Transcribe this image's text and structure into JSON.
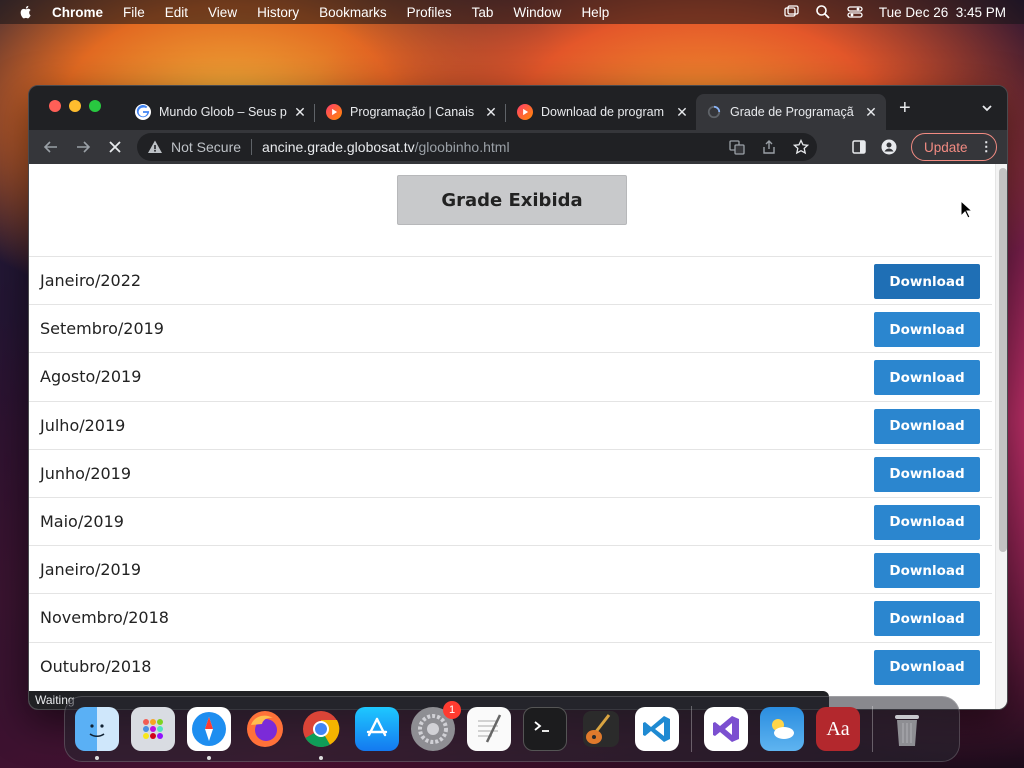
{
  "menubar": {
    "app_name": "Chrome",
    "items": [
      "File",
      "Edit",
      "View",
      "History",
      "Bookmarks",
      "Profiles",
      "Tab",
      "Window",
      "Help"
    ],
    "datetime": "Tue Dec 26  3:45 PM"
  },
  "tabs": [
    {
      "title": "Mundo Gloob – Seus p",
      "icon": "google-icon",
      "active": false
    },
    {
      "title": "Programação | Canais",
      "icon": "globoplay-icon",
      "active": false
    },
    {
      "title": "Download de program",
      "icon": "globoplay-icon",
      "active": false
    },
    {
      "title": "Grade de Programaçã",
      "icon": "loading-spinner-icon",
      "active": true
    }
  ],
  "toolbar": {
    "security_label": "Not Secure",
    "url_host": "ancine.grade.globosat.tv",
    "url_path": "/gloobinho.html",
    "update_label": "Update"
  },
  "page": {
    "header_button": "Grade Exibida",
    "download_label": "Download",
    "rows": [
      {
        "label": "Janeiro/2022",
        "hovered": true
      },
      {
        "label": "Setembro/2019",
        "hovered": false
      },
      {
        "label": "Agosto/2019",
        "hovered": false
      },
      {
        "label": "Julho/2019",
        "hovered": false
      },
      {
        "label": "Junho/2019",
        "hovered": false
      },
      {
        "label": "Maio/2019",
        "hovered": false
      },
      {
        "label": "Janeiro/2019",
        "hovered": false
      },
      {
        "label": "Novembro/2018",
        "hovered": false
      },
      {
        "label": "Outubro/2018",
        "hovered": false
      }
    ],
    "status_text": "Waiting"
  },
  "dock": {
    "apps": [
      "finder-icon",
      "launchpad-icon",
      "safari-icon",
      "firefox-icon",
      "chrome-icon",
      "app-store-icon",
      "system-settings-icon",
      "textedit-icon",
      "terminal-icon",
      "garageband-icon",
      "vscode-icon",
      "visual-studio-icon",
      "weather-icon",
      "dictionary-icon",
      "trash-icon"
    ],
    "system_settings_badge": "1"
  },
  "colors": {
    "download_button": "#2b86cf",
    "download_button_hover": "#1f6fb5",
    "header_button_bg": "#c8c9cb",
    "update_accent": "#f28b82"
  }
}
